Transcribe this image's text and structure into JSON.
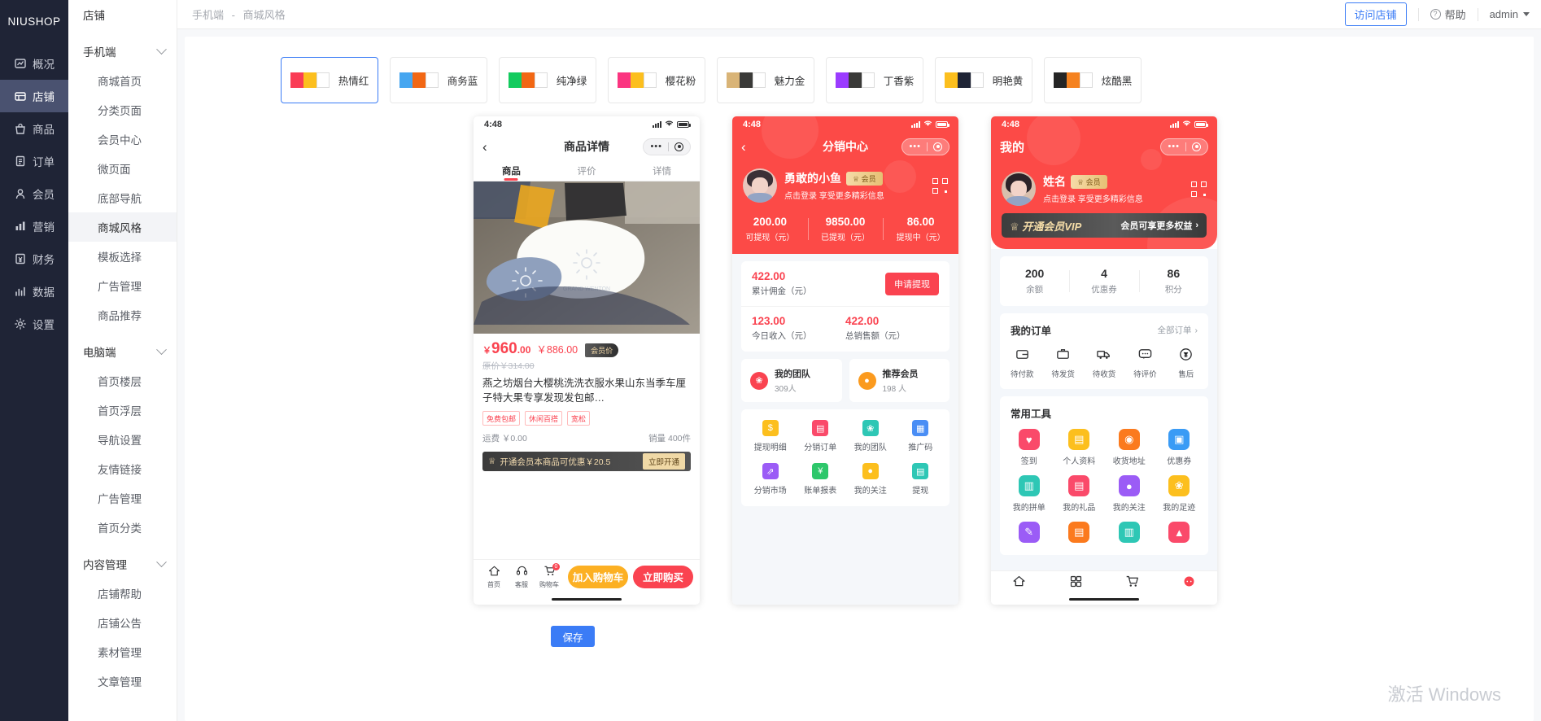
{
  "brand": "NIUSHOP",
  "rail": {
    "items": [
      {
        "label": "概况",
        "icon": "dashboard-icon",
        "active": false
      },
      {
        "label": "店铺",
        "icon": "shop-icon",
        "active": true
      },
      {
        "label": "商品",
        "icon": "goods-icon",
        "active": false
      },
      {
        "label": "订单",
        "icon": "order-icon",
        "active": false
      },
      {
        "label": "会员",
        "icon": "member-icon",
        "active": false
      },
      {
        "label": "营销",
        "icon": "marketing-icon",
        "active": false
      },
      {
        "label": "财务",
        "icon": "finance-icon",
        "active": false
      },
      {
        "label": "数据",
        "icon": "data-icon",
        "active": false
      },
      {
        "label": "设置",
        "icon": "settings-icon",
        "active": false
      }
    ]
  },
  "subnav": {
    "title": "店铺",
    "groups": [
      {
        "label": "手机端",
        "items": [
          {
            "label": "商城首页",
            "active": false
          },
          {
            "label": "分类页面",
            "active": false
          },
          {
            "label": "会员中心",
            "active": false
          },
          {
            "label": "微页面",
            "active": false
          },
          {
            "label": "底部导航",
            "active": false
          },
          {
            "label": "商城风格",
            "active": true
          },
          {
            "label": "模板选择",
            "active": false
          },
          {
            "label": "广告管理",
            "active": false
          },
          {
            "label": "商品推荐",
            "active": false
          }
        ]
      },
      {
        "label": "电脑端",
        "items": [
          {
            "label": "首页楼层",
            "active": false
          },
          {
            "label": "首页浮层",
            "active": false
          },
          {
            "label": "导航设置",
            "active": false
          },
          {
            "label": "友情链接",
            "active": false
          },
          {
            "label": "广告管理",
            "active": false
          },
          {
            "label": "首页分类",
            "active": false
          }
        ]
      },
      {
        "label": "内容管理",
        "items": [
          {
            "label": "店铺帮助",
            "active": false
          },
          {
            "label": "店铺公告",
            "active": false
          },
          {
            "label": "素材管理",
            "active": false
          },
          {
            "label": "文章管理",
            "active": false
          }
        ]
      }
    ]
  },
  "topbar": {
    "breadcrumb_parent": "手机端",
    "breadcrumb_sep": "-",
    "breadcrumb_current": "商城风格",
    "visit_shop": "访问店铺",
    "help": "帮助",
    "admin": "admin"
  },
  "themes": [
    {
      "name": "热情红",
      "c1": "#fa3c55",
      "c2": "#fcbf1e",
      "selected": true
    },
    {
      "name": "商务蓝",
      "c1": "#46a6f0",
      "c2": "#f26714",
      "selected": false
    },
    {
      "name": "纯净绿",
      "c1": "#13cb5e",
      "c2": "#f26714",
      "selected": false
    },
    {
      "name": "樱花粉",
      "c1": "#fb3580",
      "c2": "#fcbf1e",
      "selected": false
    },
    {
      "name": "魅力金",
      "c1": "#d9b477",
      "c2": "#3a3a38",
      "selected": false
    },
    {
      "name": "丁香紫",
      "c1": "#9b3cff",
      "c2": "#3a3a38",
      "selected": false
    },
    {
      "name": "明艳黄",
      "c1": "#fcbf1e",
      "c2": "#1f2436",
      "selected": false
    },
    {
      "name": "炫酷黑",
      "c1": "#252525",
      "c2": "#f58220",
      "selected": false
    }
  ],
  "phone1": {
    "status_time": "4:48",
    "nav_title": "商品详情",
    "tabs": [
      {
        "label": "商品",
        "active": true
      },
      {
        "label": "评价",
        "active": false
      },
      {
        "label": "详情",
        "active": false
      }
    ],
    "price_currency": "￥",
    "price_int": "960",
    "price_dec": ".00",
    "price_member": "￥886.00",
    "member_badge": "会员价",
    "original_price": "原价￥314.00",
    "title": "燕之坊烟台大樱桃洗洗衣服水果山东当季车厘子特大果专享发现发包邮…",
    "tags": [
      "免费包邮",
      "休闲百搭",
      "宽松"
    ],
    "shipping": "运费 ￥0.00",
    "sales": "销量 400件",
    "vip_text": "开通会员本商品可优惠￥20.5",
    "vip_action": "立即开通",
    "bottom_icons": [
      {
        "label": "首页",
        "icon": "home-icon",
        "badge": ""
      },
      {
        "label": "客服",
        "icon": "service-icon",
        "badge": ""
      },
      {
        "label": "购物车",
        "icon": "cart-icon",
        "badge": "0"
      }
    ],
    "add_cart": "加入购物车",
    "buy_now": "立即购买"
  },
  "phone2": {
    "status_time": "4:48",
    "nav_title": "分销中心",
    "user_name": "勇敢的小鱼",
    "user_badge": "会员",
    "user_sub": "点击登录 享受更多精彩信息",
    "stats": [
      {
        "value": "200.00",
        "label": "可提现（元）"
      },
      {
        "value": "9850.00",
        "label": "已提现（元）"
      },
      {
        "value": "86.00",
        "label": "提现中（元）"
      }
    ],
    "commission_value": "422.00",
    "commission_label": "累计佣金（元）",
    "withdraw_button": "申请提现",
    "today_value": "123.00",
    "today_label": "今日收入（元）",
    "total_value": "422.00",
    "total_label": "总销售额（元）",
    "team_title": "我的团队",
    "team_sub": "309人",
    "refer_title": "推荐会员",
    "refer_sub": "198 人",
    "tools": [
      {
        "label": "提现明细",
        "icon": "money-bag-icon",
        "color": "#fcbf1e"
      },
      {
        "label": "分销订单",
        "icon": "order-doc-icon",
        "color": "#fa4a6a"
      },
      {
        "label": "我的团队",
        "icon": "team-icon",
        "color": "#2ec7b5"
      },
      {
        "label": "推广码",
        "icon": "qr-code-icon",
        "color": "#4a8ef5"
      },
      {
        "label": "分销市场",
        "icon": "market-icon",
        "color": "#9b5cf6"
      },
      {
        "label": "账单报表",
        "icon": "report-icon",
        "color": "#2ec76b"
      },
      {
        "label": "我的关注",
        "icon": "follow-icon",
        "color": "#fcbf1e"
      },
      {
        "label": "提现",
        "icon": "withdraw-icon",
        "color": "#2ec7b5"
      }
    ]
  },
  "phone3": {
    "status_time": "4:48",
    "nav_title": "我的",
    "user_name": "姓名",
    "user_badge": "会员",
    "user_sub": "点击登录 享受更多精彩信息",
    "vip_left": "开通会员VIP",
    "vip_right": "会员可享更多权益",
    "stats": [
      {
        "value": "200",
        "label": "余额"
      },
      {
        "value": "4",
        "label": "优惠券"
      },
      {
        "value": "86",
        "label": "积分"
      }
    ],
    "orders_title": "我的订单",
    "orders_more": "全部订单",
    "order_steps": [
      {
        "label": "待付款",
        "icon": "wallet-icon"
      },
      {
        "label": "待发货",
        "icon": "box-icon"
      },
      {
        "label": "待收货",
        "icon": "truck-icon"
      },
      {
        "label": "待评价",
        "icon": "comment-icon"
      },
      {
        "label": "售后",
        "icon": "refund-icon"
      }
    ],
    "tools_title": "常用工具",
    "tools": [
      {
        "label": "签到",
        "icon": "checkin-icon",
        "color": "#fa4a6a"
      },
      {
        "label": "个人资料",
        "icon": "profile-icon",
        "color": "#fcbf1e"
      },
      {
        "label": "收货地址",
        "icon": "location-icon",
        "color": "#fb7a1e"
      },
      {
        "label": "优惠券",
        "icon": "coupon-icon",
        "color": "#3a9bf5"
      },
      {
        "label": "我的拼单",
        "icon": "group-buy-icon",
        "color": "#2ec7b5"
      },
      {
        "label": "我的礼品",
        "icon": "gift-icon",
        "color": "#fa4a6a"
      },
      {
        "label": "我的关注",
        "icon": "follow-icon",
        "color": "#9b5cf6"
      },
      {
        "label": "我的足迹",
        "icon": "footprint-icon",
        "color": "#fcbf1e"
      },
      {
        "label": "",
        "icon": "brush-icon",
        "color": "#9b5cf6"
      },
      {
        "label": "",
        "icon": "stack-icon",
        "color": "#fb7a1e"
      },
      {
        "label": "",
        "icon": "tree-icon",
        "color": "#2ec7b5"
      },
      {
        "label": "",
        "icon": "fire-icon",
        "color": "#fa4a6a"
      }
    ],
    "tabbar": [
      {
        "label": "首页",
        "icon": "home-icon",
        "active": false
      },
      {
        "label": "分类",
        "icon": "category-icon",
        "active": false
      },
      {
        "label": "购物车",
        "icon": "cart-icon",
        "active": false
      },
      {
        "label": "我的",
        "icon": "user-icon",
        "active": true
      }
    ]
  },
  "save_button": "保存",
  "watermark": "激活 Windows"
}
